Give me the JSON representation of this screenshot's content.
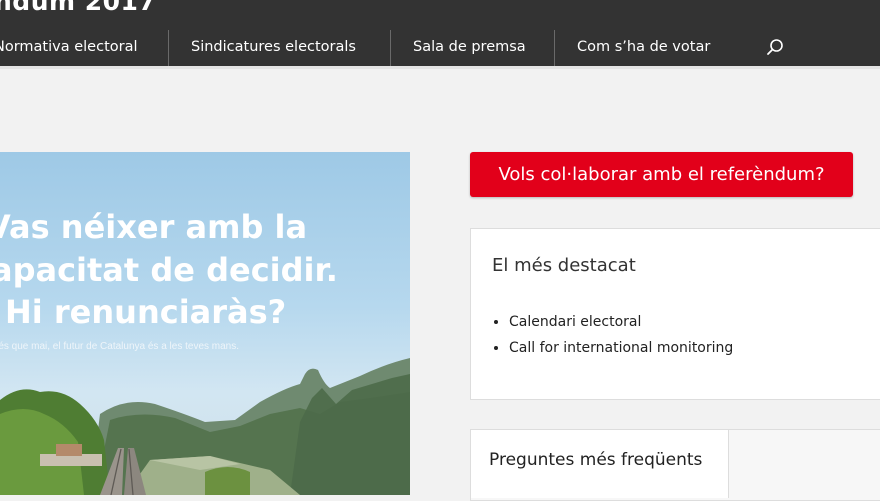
{
  "header": {
    "title": "ndum 2017",
    "nav": [
      {
        "label": "Normativa electoral"
      },
      {
        "label": "Sindicatures electorals"
      },
      {
        "label": "Sala de premsa"
      },
      {
        "label": "Com s’ha de votar"
      }
    ]
  },
  "hero": {
    "heading_lines": [
      "Vas néixer amb la",
      "capacitat de decidir.",
      "Hi renunciaràs?"
    ],
    "subtitle": "Més que mai, el futur de Catalunya és a les teves mans."
  },
  "cta": {
    "label": "Vols col·laborar amb el referèndum?",
    "color": "#e2001a"
  },
  "featured": {
    "title": "El més destacat",
    "items": [
      "Calendari electoral",
      "Call for international monitoring"
    ]
  },
  "tabs": {
    "active_label": "Preguntes més freqüents"
  }
}
